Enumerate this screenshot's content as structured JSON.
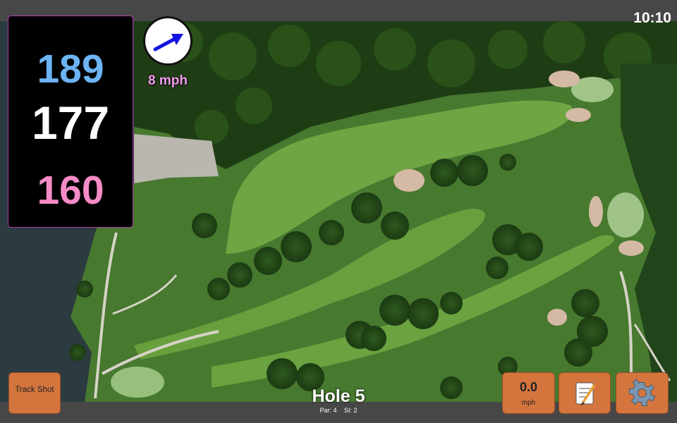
{
  "status": {
    "time": "10:10"
  },
  "distances": {
    "back": "189",
    "middle": "177",
    "front": "160"
  },
  "wind": {
    "speed_label": "8 mph",
    "direction_icon": "arrow-icon"
  },
  "buttons": {
    "track_shot": "Track Shot",
    "speed_value": "0.0",
    "speed_unit": "mph",
    "notes_icon": "notepad-icon",
    "settings_icon": "gear-icon"
  },
  "hole": {
    "title": "Hole 5",
    "par": "Par: 4",
    "si": "SI: 2"
  },
  "colors": {
    "back": "#6cb4f5",
    "middle": "#ffffff",
    "front": "#f58bc6",
    "button": "#d4753e",
    "wind_text": "#f39cf0",
    "bar": "#474747"
  }
}
